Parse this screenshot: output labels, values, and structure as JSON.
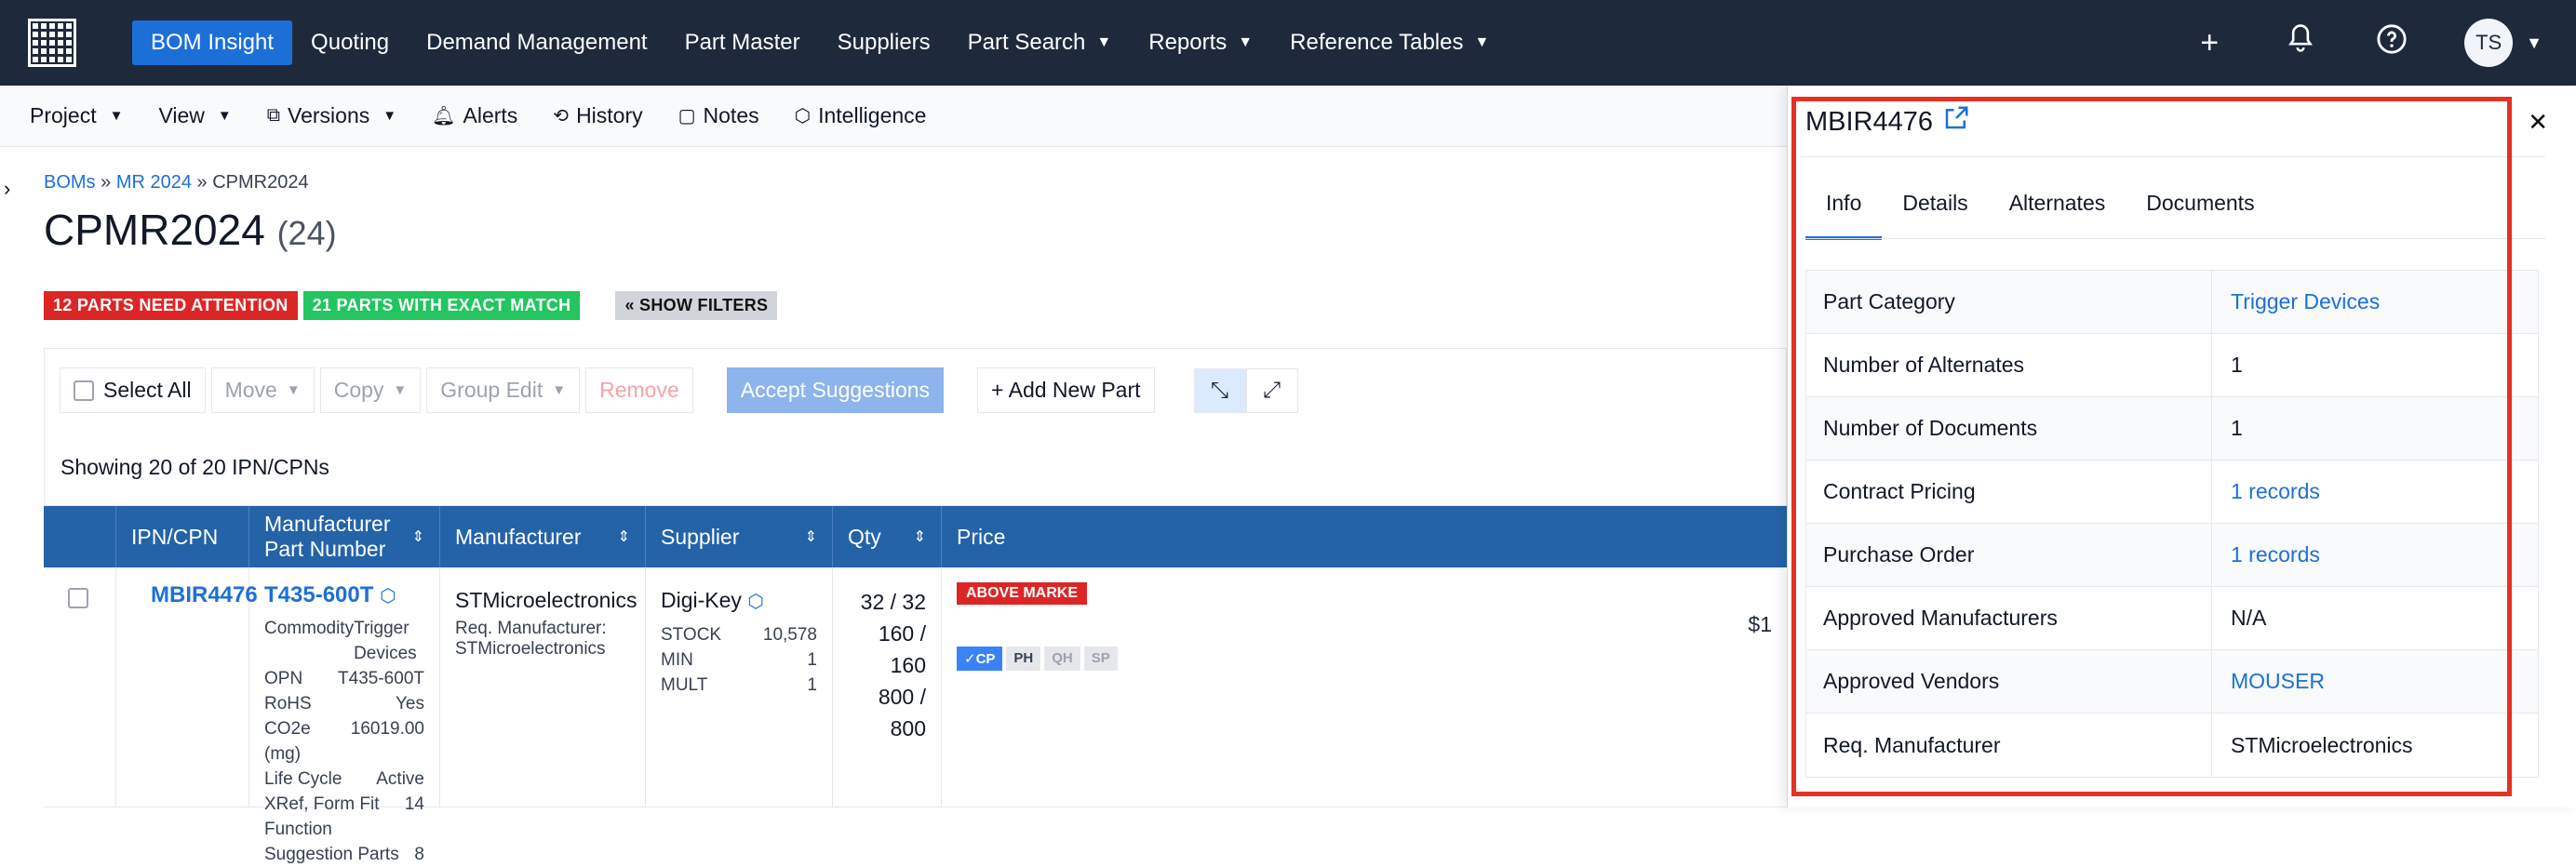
{
  "nav": {
    "items": [
      {
        "label": "BOM Insight",
        "active": true,
        "dropdown": false
      },
      {
        "label": "Quoting",
        "active": false,
        "dropdown": false
      },
      {
        "label": "Demand Management",
        "active": false,
        "dropdown": false
      },
      {
        "label": "Part Master",
        "active": false,
        "dropdown": false
      },
      {
        "label": "Suppliers",
        "active": false,
        "dropdown": false
      },
      {
        "label": "Part Search",
        "active": false,
        "dropdown": true
      },
      {
        "label": "Reports",
        "active": false,
        "dropdown": true
      },
      {
        "label": "Reference Tables",
        "active": false,
        "dropdown": true
      }
    ],
    "avatar_initials": "TS",
    "icons": {
      "add": "plus-icon",
      "notifications": "bell-icon",
      "help": "help-circle-icon"
    }
  },
  "subbar": {
    "project": "Project",
    "view": "View",
    "versions": "Versions",
    "alerts": "Alerts",
    "history": "History",
    "notes": "Notes",
    "intelligence": "Intelligence"
  },
  "breadcrumb": {
    "first": "BOMs",
    "second": "MR 2024",
    "current": "CPMR2024",
    "sep": "»"
  },
  "page": {
    "title": "CPMR2024",
    "count": "(24)"
  },
  "badges": {
    "attention": "12 PARTS NEED ATTENTION",
    "exact": "21 PARTS WITH EXACT MATCH",
    "filters": "« SHOW FILTERS"
  },
  "actions": {
    "select_all": "Select All",
    "move": "Move",
    "copy": "Copy",
    "group_edit": "Group Edit",
    "remove": "Remove",
    "accept": "Accept Suggestions",
    "add_new": "+ Add New Part"
  },
  "showing": "Showing 20 of 20 IPN/CPNs",
  "table": {
    "headers": [
      "IPN/CPN",
      "Manufacturer Part Number",
      "Manufacturer",
      "Supplier",
      "Qty",
      "Price"
    ],
    "row": {
      "ipn": "MBIR4476",
      "mpn": "T435-600T",
      "details": [
        {
          "k": "Commodity",
          "v": "Trigger Devices"
        },
        {
          "k": "OPN",
          "v": "T435-600T"
        },
        {
          "k": "RoHS",
          "v": "Yes"
        },
        {
          "k": "CO2e (mg)",
          "v": "16019.00"
        },
        {
          "k": "Life Cycle",
          "v": "Active"
        },
        {
          "k": "XRef, Form Fit Function",
          "v": "14"
        },
        {
          "k": "Suggestion Parts",
          "v": "8"
        }
      ],
      "manufacturer": "STMicroelectronics",
      "req_manufacturer_label": "Req. Manufacturer:",
      "req_manufacturer": "STMicroelectronics",
      "supplier": "Digi-Key",
      "supplier_stats": [
        {
          "k": "STOCK",
          "v": "10,578"
        },
        {
          "k": "MIN",
          "v": "1"
        },
        {
          "k": "MULT",
          "v": "1"
        }
      ],
      "qty": [
        "32 / 32",
        "160 / 160",
        "800 / 800"
      ],
      "price_badge": "ABOVE MARKE",
      "price_value": "$1",
      "price_chips": [
        "✓CP",
        "PH",
        "QH",
        "SP"
      ]
    }
  },
  "panel": {
    "title": "MBIR4476",
    "tabs": [
      "Info",
      "Details",
      "Alternates",
      "Documents"
    ],
    "active_tab": "Info",
    "info": [
      {
        "k": "Part Category",
        "v": "Trigger Devices",
        "link": true
      },
      {
        "k": "Number of Alternates",
        "v": "1",
        "link": false
      },
      {
        "k": "Number of Documents",
        "v": "1",
        "link": false
      },
      {
        "k": "Contract Pricing",
        "v": "1 records",
        "link": true
      },
      {
        "k": "Purchase Order",
        "v": "1 records",
        "link": true
      },
      {
        "k": "Approved Manufacturers",
        "v": "N/A",
        "link": false
      },
      {
        "k": "Approved Vendors",
        "v": "MOUSER",
        "link": true
      },
      {
        "k": "Req. Manufacturer",
        "v": "STMicroelectronics",
        "link": false
      }
    ]
  }
}
